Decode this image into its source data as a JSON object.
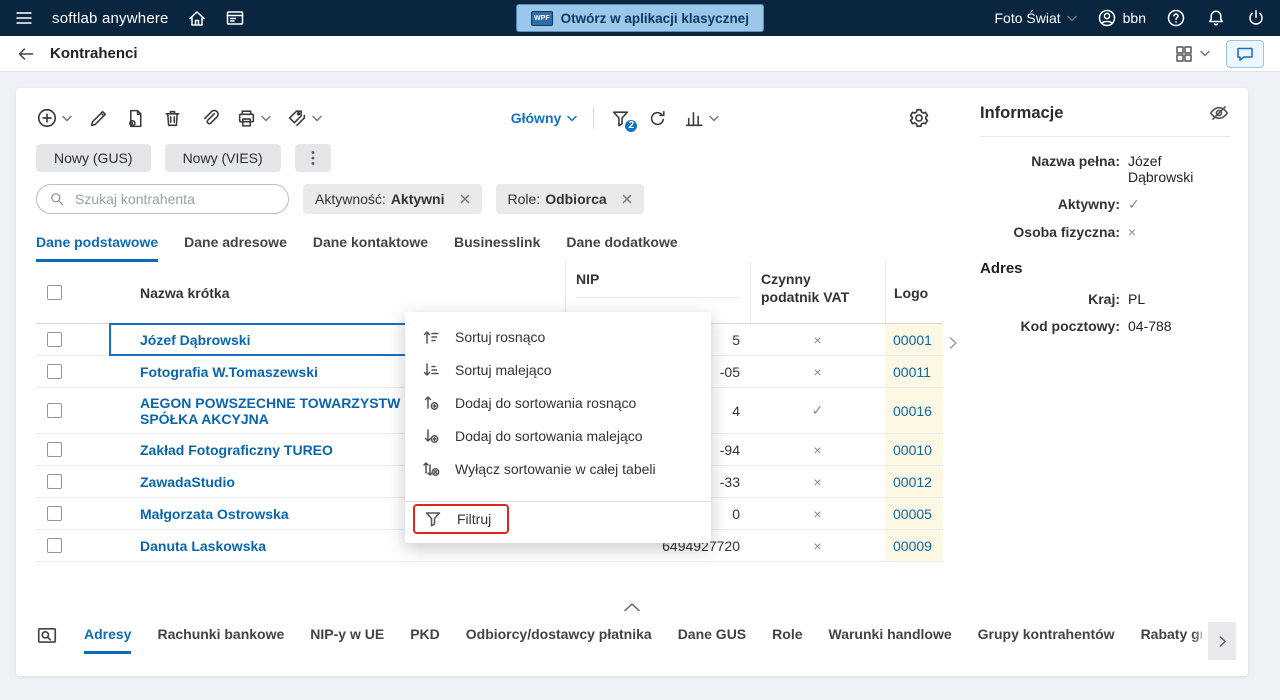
{
  "topbar": {
    "app_name": "softlab anywhere",
    "classic_button": "Otwórz w aplikacji klasycznej",
    "classic_badge": "WPF",
    "company": "Foto Świat",
    "user": "bbn"
  },
  "header": {
    "title": "Kontrahenci"
  },
  "toolbar": {
    "view": "Główny",
    "filter_count": "2"
  },
  "actions": {
    "new_gus": "Nowy (GUS)",
    "new_vies": "Nowy (VIES)"
  },
  "search": {
    "placeholder": "Szukaj kontrahenta"
  },
  "chips": [
    {
      "label": "Aktywność:",
      "value": "Aktywni"
    },
    {
      "label": "Role:",
      "value": "Odbiorca"
    }
  ],
  "tabs": [
    {
      "label": "Dane podstawowe"
    },
    {
      "label": "Dane adresowe"
    },
    {
      "label": "Dane kontaktowe"
    },
    {
      "label": "Businesslink"
    },
    {
      "label": "Dane dodatkowe"
    }
  ],
  "table": {
    "headers": {
      "name": "Nazwa krótka",
      "nip": "NIP",
      "vat_line1": "Czynny",
      "vat_line2": "podatnik VAT",
      "logo": "Logo"
    },
    "rows": [
      {
        "name": "Józef Dąbrowski",
        "nip": "5",
        "vat": "×",
        "logo": "00001"
      },
      {
        "name": "Fotografia W.Tomaszewski",
        "nip": "-05",
        "vat": "×",
        "logo": "00011"
      },
      {
        "name": "AEGON POWSZECHNE TOWARZYSTW",
        "name2": "SPÓŁKA AKCYJNA",
        "nip": "4",
        "vat": "✓",
        "logo": "00016"
      },
      {
        "name": "Zakład Fotograficzny TUREO",
        "nip": "-94",
        "vat": "×",
        "logo": "00010"
      },
      {
        "name": "ZawadaStudio",
        "nip": "-33",
        "vat": "×",
        "logo": "00012"
      },
      {
        "name": "Małgorzata Ostrowska",
        "nip": "0",
        "vat": "×",
        "logo": "00005"
      },
      {
        "name": "Danuta Laskowska",
        "nip": "6494927720",
        "vat": "×",
        "logo": "00009"
      }
    ]
  },
  "context_menu": {
    "items": [
      {
        "label": "Sortuj rosnąco"
      },
      {
        "label": "Sortuj malejąco"
      },
      {
        "label": "Dodaj do sortowania rosnąco"
      },
      {
        "label": "Dodaj do sortowania malejąco"
      },
      {
        "label": "Wyłącz sortowanie w całej tabeli"
      },
      {
        "label": "Filtruj"
      }
    ]
  },
  "bottom": {
    "tabs": [
      "Adresy",
      "Rachunki bankowe",
      "NIP-y w UE",
      "PKD",
      "Odbiorcy/dostawcy płatnika",
      "Dane GUS",
      "Role",
      "Warunki handlowe",
      "Grupy kontrahentów",
      "Rabaty grup materiałowych"
    ]
  },
  "info_panel": {
    "title": "Informacje",
    "fields": [
      {
        "label": "Nazwa pełna:",
        "value": "Józef Dąbrowski"
      },
      {
        "label": "Aktywny:",
        "value": "✓"
      },
      {
        "label": "Osoba fizyczna:",
        "value": "×"
      }
    ],
    "section_title": "Adres",
    "address_fields": [
      {
        "label": "Kraj:",
        "value": "PL"
      },
      {
        "label": "Kod pocztowy:",
        "value": "04-788"
      }
    ]
  },
  "colors": {
    "topbar": "#0a2540",
    "accent": "#1272c4",
    "link": "#0a66ad",
    "logo_highlight": "#fcf8e3",
    "annotation_red": "#e0261f"
  }
}
